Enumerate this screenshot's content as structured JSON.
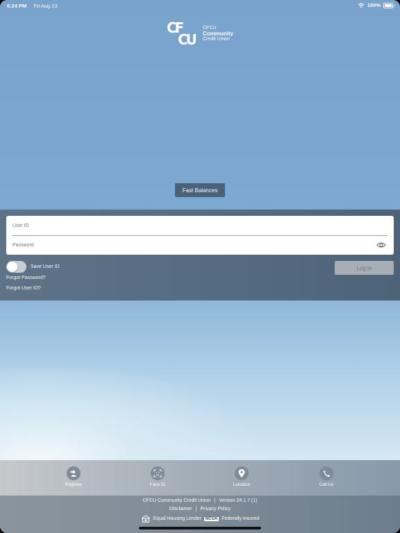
{
  "status_bar": {
    "time": "6:24 PM",
    "date": "Fri Aug 23",
    "battery": "100%"
  },
  "logo": {
    "mark_line1": "CF",
    "mark_line2": "CU",
    "line1": "CFCU",
    "line2": "Community",
    "line3": "Credit Union"
  },
  "fast_balances_label": "Fast Balances",
  "login": {
    "user_id_placeholder": "User ID",
    "password_placeholder": "Password",
    "save_user_id_label": "Save User ID",
    "save_user_id_on": false,
    "forgot_password": "Forgot Password?",
    "forgot_user_id": "Forgot User ID?",
    "login_button": "Log in"
  },
  "bottom_nav": [
    {
      "label": "Register",
      "icon": "person-add-icon"
    },
    {
      "label": "Face ID",
      "icon": "face-id-icon"
    },
    {
      "label": "Location",
      "icon": "location-pin-icon"
    },
    {
      "label": "Call Us",
      "icon": "phone-icon"
    }
  ],
  "footer": {
    "org": "CFCU Community Credit Union",
    "version": "Version 24.1.7 (1)",
    "disclaimer": "Disclaimer",
    "privacy": "Privacy Policy",
    "equal_housing": "Equal Housing Lender",
    "ncua": "NCUA",
    "federally_insured": "Federally Insured"
  },
  "colors": {
    "sky_top": "#79a3cc",
    "panel": "#536a80",
    "fast_balances_bg": "#4b6178",
    "login_button_bg": "#a7aeb5"
  }
}
